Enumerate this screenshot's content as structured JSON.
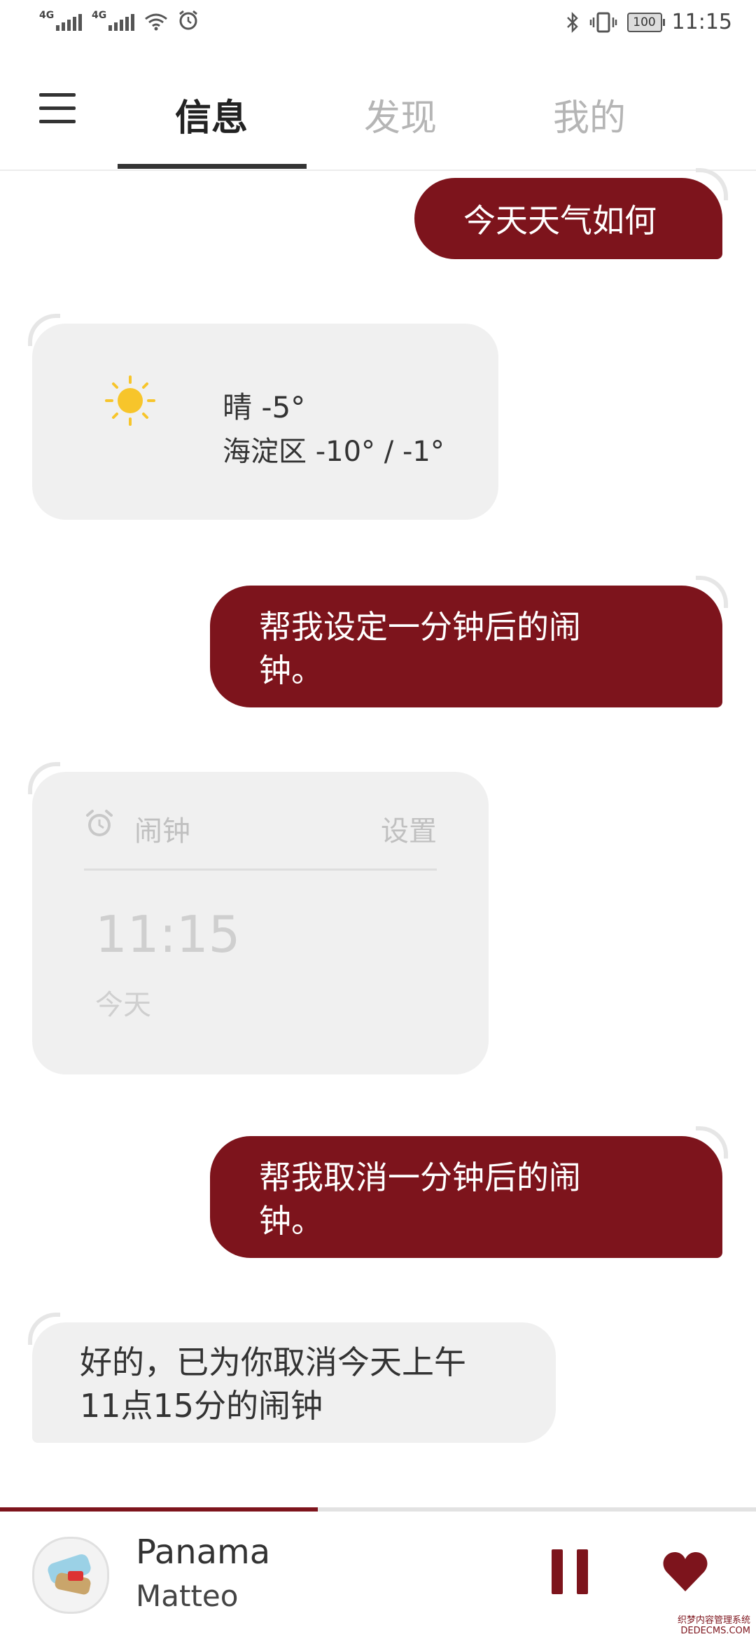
{
  "status_bar": {
    "signal1_label": "4G",
    "signal2_label": "4G",
    "battery": "100",
    "time": "11:15"
  },
  "nav": {
    "tabs": [
      {
        "label": "信息",
        "active": true
      },
      {
        "label": "发现",
        "active": false
      },
      {
        "label": "我的",
        "active": false
      }
    ]
  },
  "messages": {
    "m1": {
      "from": "user",
      "text": "今天天气如何"
    },
    "weather": {
      "condition": "晴 -5°",
      "detail": "海淀区 -10° / -1°",
      "icon": "sun-icon"
    },
    "m2": {
      "from": "user",
      "line1": "帮我设定一分钟后的闹",
      "line2": "钟。"
    },
    "alarm": {
      "title": "闹钟",
      "settings": "设置",
      "time": "11:15",
      "day": "今天",
      "icon": "alarm-clock-icon"
    },
    "m3": {
      "from": "user",
      "line1": "帮我取消一分钟后的闹",
      "line2": "钟。"
    },
    "m4": {
      "from": "bot",
      "line1": "好的，已为你取消今天上午",
      "line2": "11点15分的闹钟"
    }
  },
  "player": {
    "title": "Panama",
    "artist": "Matteo",
    "progress": 0.42,
    "icons": [
      "pause-icon",
      "heart-icon"
    ]
  },
  "watermark": {
    "line1": "织梦内容管理系统",
    "line2": "DEDECMS.COM"
  },
  "colors": {
    "accent": "#7d141c",
    "bot_bubble": "#f0f0f0"
  }
}
